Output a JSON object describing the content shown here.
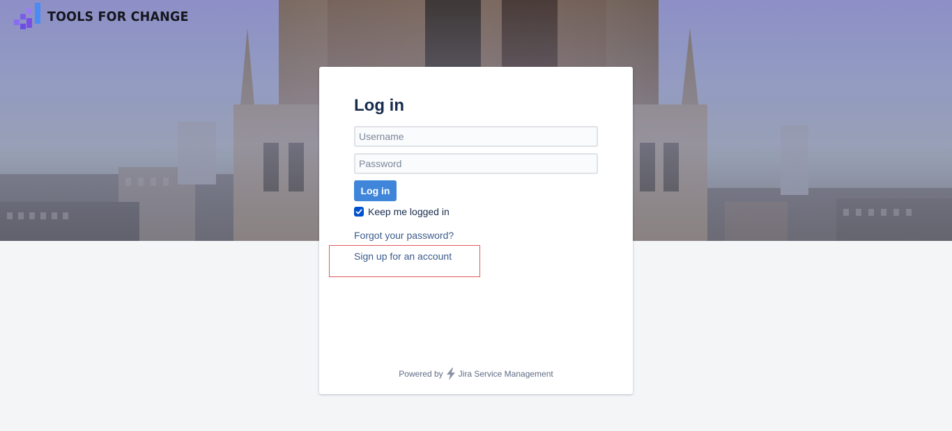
{
  "brand": {
    "name": "TOOLS FOR CHANGE",
    "logo_icon": "bar-chart-logo-icon"
  },
  "login": {
    "title": "Log in",
    "username_placeholder": "Username",
    "username_value": "",
    "password_placeholder": "Password",
    "password_value": "",
    "submit_label": "Log in",
    "remember_label": "Keep me logged in",
    "remember_checked": true,
    "forgot_link": "Forgot your password?",
    "signup_link": "Sign up for an account"
  },
  "footer": {
    "powered_prefix": "Powered by",
    "product_name": "Jira Service Management",
    "product_icon": "lightning-bolt-icon"
  },
  "colors": {
    "primary_button": "#3f86da",
    "checkbox": "#0052cc",
    "link": "#3b5b8c",
    "highlight": "#e05858",
    "page_background": "#f4f5f7"
  }
}
